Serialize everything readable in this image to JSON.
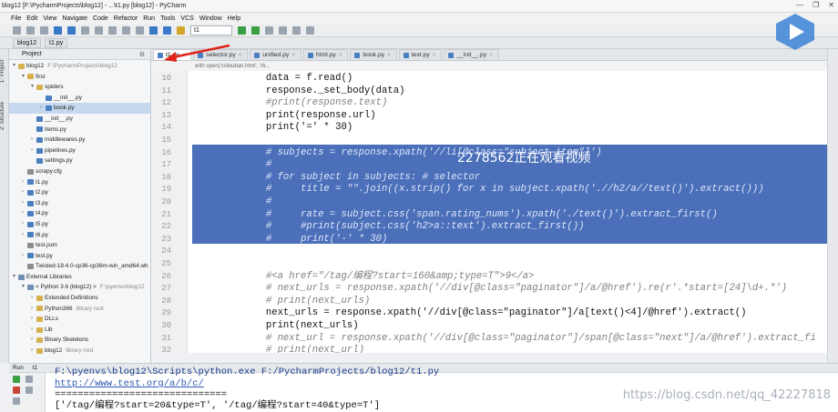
{
  "window": {
    "title": "blog12 [F:\\PycharmProjects\\blog12] - ...\\t1.py [blog12] - PyCharm",
    "controls": [
      "—",
      "❐",
      "✕"
    ]
  },
  "menu": [
    "File",
    "Edit",
    "View",
    "Navigate",
    "Code",
    "Refactor",
    "Run",
    "Tools",
    "VCS",
    "Window",
    "Help"
  ],
  "toolbar": {
    "run_config": "t1"
  },
  "breadcrumbs": [
    "blog12",
    "t1.py"
  ],
  "left_tools": [
    "1: Project",
    "2: Structure"
  ],
  "project": {
    "header": "Project",
    "tree": [
      {
        "label": "blog12",
        "extra": "F:\\PycharmProjects\\blog12",
        "indent": 0,
        "type": "dir",
        "arrow": "▾"
      },
      {
        "label": "first",
        "extra": "",
        "indent": 1,
        "type": "dir",
        "arrow": "▾"
      },
      {
        "label": "spiders",
        "extra": "",
        "indent": 2,
        "type": "dir",
        "arrow": "▾"
      },
      {
        "label": "__init__.py",
        "extra": "",
        "indent": 3,
        "type": "py",
        "arrow": ""
      },
      {
        "label": "book.py",
        "extra": "",
        "indent": 3,
        "type": "py",
        "arrow": "›",
        "selected": true
      },
      {
        "label": "__init__.py",
        "extra": "",
        "indent": 2,
        "type": "py",
        "arrow": ""
      },
      {
        "label": "items.py",
        "extra": "",
        "indent": 2,
        "type": "py",
        "arrow": ""
      },
      {
        "label": "middlewares.py",
        "extra": "",
        "indent": 2,
        "type": "py",
        "arrow": "›"
      },
      {
        "label": "pipelines.py",
        "extra": "",
        "indent": 2,
        "type": "py",
        "arrow": "›"
      },
      {
        "label": "settings.py",
        "extra": "",
        "indent": 2,
        "type": "py",
        "arrow": ""
      },
      {
        "label": "scrapy.cfg",
        "extra": "",
        "indent": 1,
        "type": "cfg",
        "arrow": ""
      },
      {
        "label": "t1.py",
        "extra": "",
        "indent": 1,
        "type": "py",
        "arrow": "›"
      },
      {
        "label": "t2.py",
        "extra": "",
        "indent": 1,
        "type": "py",
        "arrow": "›"
      },
      {
        "label": "t3.py",
        "extra": "",
        "indent": 1,
        "type": "py",
        "arrow": "›"
      },
      {
        "label": "t4.py",
        "extra": "",
        "indent": 1,
        "type": "py",
        "arrow": "›"
      },
      {
        "label": "t5.py",
        "extra": "",
        "indent": 1,
        "type": "py",
        "arrow": "›"
      },
      {
        "label": "t6.py",
        "extra": "",
        "indent": 1,
        "type": "py",
        "arrow": "›"
      },
      {
        "label": "test.json",
        "extra": "",
        "indent": 1,
        "type": "cfg",
        "arrow": ""
      },
      {
        "label": "test.py",
        "extra": "",
        "indent": 1,
        "type": "py",
        "arrow": "›"
      },
      {
        "label": "Twisted-18.4.0-cp36-cp36m-win_amd64.wh",
        "extra": "",
        "indent": 1,
        "type": "cfg",
        "arrow": ""
      },
      {
        "label": "External Libraries",
        "extra": "",
        "indent": 0,
        "type": "lib",
        "arrow": "▾"
      },
      {
        "label": "< Python 3.6 (blog12) >",
        "extra": "F:\\pyenvs\\blog12",
        "indent": 1,
        "type": "lib",
        "arrow": "▾"
      },
      {
        "label": "Extended Definitions",
        "extra": "",
        "indent": 2,
        "type": "dir",
        "arrow": "›"
      },
      {
        "label": "Python366",
        "extra": "library root",
        "indent": 2,
        "type": "dir",
        "arrow": "›"
      },
      {
        "label": "DLLs",
        "extra": "",
        "indent": 2,
        "type": "dir",
        "arrow": "›"
      },
      {
        "label": "Lib",
        "extra": "",
        "indent": 2,
        "type": "dir",
        "arrow": "›"
      },
      {
        "label": "Binary Skeletons",
        "extra": "",
        "indent": 2,
        "type": "dir",
        "arrow": "›"
      },
      {
        "label": "blog12",
        "extra": "library root",
        "indent": 2,
        "type": "dir",
        "arrow": "›"
      }
    ]
  },
  "tabs": [
    {
      "label": "t1.py",
      "active": true
    },
    {
      "label": "selector.py",
      "active": false
    },
    {
      "label": "unified.py",
      "active": false
    },
    {
      "label": "html.py",
      "active": false
    },
    {
      "label": "book.py",
      "active": false
    },
    {
      "label": "text.py",
      "active": false
    },
    {
      "label": "__init__.py",
      "active": false
    }
  ],
  "editor_hint": "with open('c/douban.html', 'rb...",
  "code": {
    "line_numbers": [
      "10",
      "11",
      "12",
      "13",
      "14",
      "15",
      "16",
      "17",
      "18",
      "19",
      "20",
      "21",
      "22",
      "23",
      "24",
      "25",
      "26",
      "27",
      "28",
      "29",
      "30",
      "31",
      "32"
    ],
    "lines": [
      "        data = f.read()",
      "        response._set_body(data)",
      "        #print(response.text)",
      "        print(response.url)",
      "        print('=' * 30)",
      "",
      "        # subjects = response.xpath('//li[@class=\"subject-item\"]')",
      "        #",
      "        # for subject in subjects: # selector",
      "        #     title = \"\".join((x.strip() for x in subject.xpath('.//h2/a//text()').extract()))",
      "        #",
      "        #     rate = subject.css('span.rating_nums').xpath('./text()').extract_first()",
      "        #     #print(subject.css('h2>a::text').extract_first())",
      "        #     print('-' * 30)",
      "",
      "",
      "        #<a href=\"/tag/编程?start=160&amp;type=T\">9</a>",
      "        # next_urls = response.xpath('//div[@class=\"paginator\"]/a/@href').re(r'.*start=[24]\\d+.*')",
      "        # print(next_urls)",
      "        next_urls = response.xpath('//div[@class=\"paginator\"]/a[text()<4]/@href').extract()",
      "        print(next_urls)",
      "        # next_url = response.xpath('//div[@class=\"paginator\"]/span[@class=\"next\"]/a/@href').extract_fi",
      "        # print(next_url)"
    ]
  },
  "video_overlay": "2278562正在观看视频",
  "run": {
    "header": "Run",
    "tab": "t1",
    "output": [
      "F:\\pyenvs\\blog12\\Scripts\\python.exe F:/PycharmProjects/blog12/t1.py",
      "http://www.test.org/a/b/c/",
      "==============================",
      "['/tag/编程?start=20&type=T', '/tag/编程?start=40&type=T']"
    ]
  },
  "watermark": "https://blog.csdn.net/qq_42227818",
  "colors": {
    "selection": "#4b6fb8",
    "comment": "#808080",
    "keyword": "#000080",
    "string": "#008000",
    "annotation_arrow": "#e0241b"
  }
}
